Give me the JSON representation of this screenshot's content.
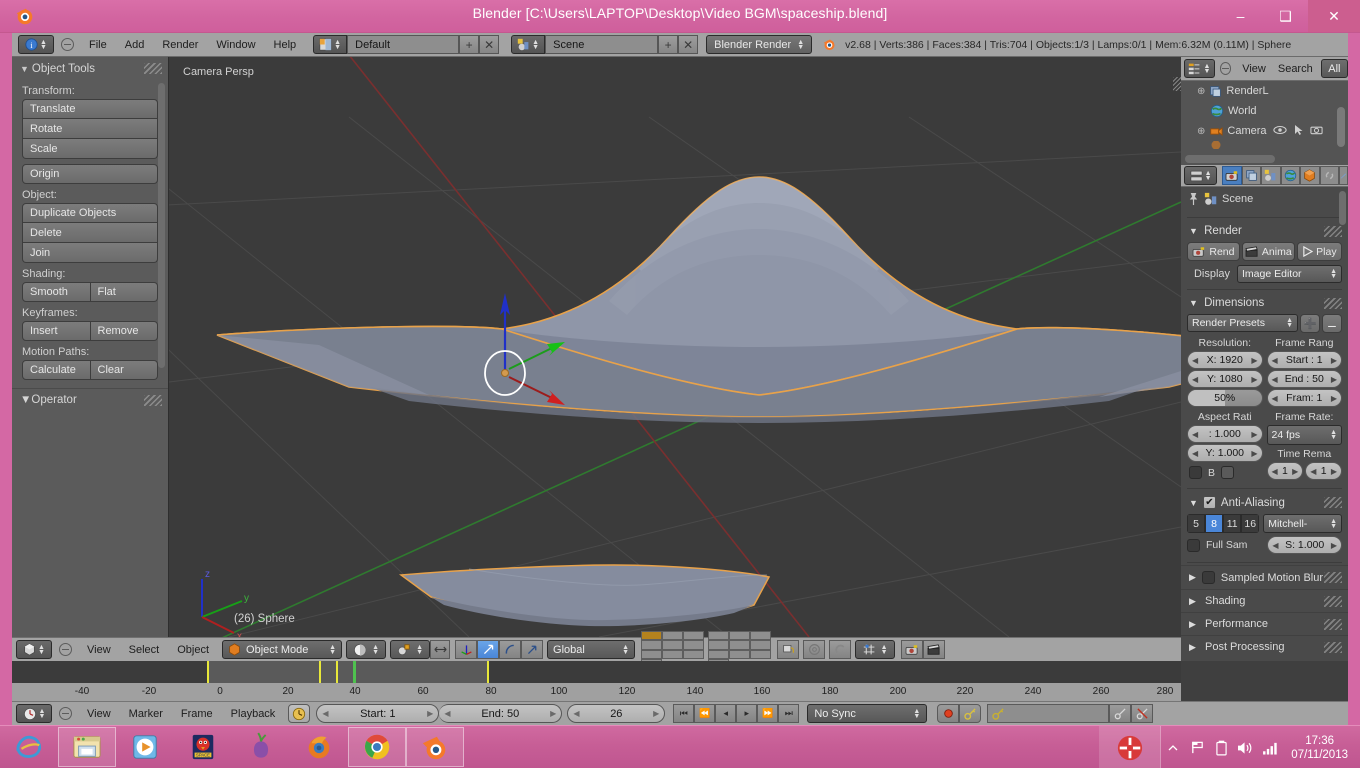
{
  "window": {
    "title": "Blender [C:\\Users\\LAPTOP\\Desktop\\Video BGM\\spaceship.blend]",
    "minimize": "–",
    "maximize": "❑",
    "close": "✕"
  },
  "header": {
    "menus": [
      "File",
      "Add",
      "Render",
      "Window",
      "Help"
    ],
    "screen_layout": "Default",
    "scene_name": "Scene",
    "engine": "Blender Render",
    "add_label": "+",
    "remove_label": "✕",
    "stats": "v2.68 | Verts:386 | Faces:384 | Tris:704 | Objects:1/3 | Lamps:0/1 | Mem:6.32M (0.11M) | Sphere"
  },
  "tool_panel": {
    "title": "Object Tools",
    "sections": [
      {
        "label": "Transform:",
        "buttons": [
          "Translate",
          "Rotate",
          "Scale"
        ]
      },
      {
        "label": "",
        "buttons": [
          "Origin"
        ]
      },
      {
        "label": "Object:",
        "buttons": [
          "Duplicate Objects",
          "Delete",
          "Join"
        ]
      },
      {
        "label": "Shading:",
        "buttons": [
          "Smooth",
          "Flat"
        ]
      },
      {
        "label": "Keyframes:",
        "buttons": [
          "Insert",
          "Remove"
        ]
      },
      {
        "label": "Motion Paths:",
        "buttons": [
          "Calculate",
          "Clear"
        ]
      }
    ],
    "operator_title": "Operator"
  },
  "viewport": {
    "view_label": "Camera Persp",
    "object_label": "(26) Sphere",
    "axis_x": "x",
    "axis_y": "y",
    "axis_z": "z",
    "header": {
      "menus": [
        "View",
        "Select",
        "Object"
      ],
      "mode": "Object Mode",
      "transform_orientation": "Global"
    }
  },
  "outliner": {
    "menus": [
      "View",
      "Search"
    ],
    "filter": "All",
    "rows": [
      {
        "name": "RenderL",
        "icon": "renderlayers-icon"
      },
      {
        "name": "World",
        "icon": "world-icon"
      },
      {
        "name": "Camera",
        "icon": "camera-icon"
      }
    ]
  },
  "properties": {
    "tabs": [
      "render-tab",
      "renderlayers-tab",
      "scene-tab",
      "world-tab",
      "object-tab",
      "constraints-tab",
      "modifiers-tab"
    ],
    "active_tab": 0,
    "scene_name": "Scene",
    "render": {
      "title": "Render",
      "render_button": "Rend",
      "animation_button": "Anima",
      "play_button": "Play",
      "display_label": "Display",
      "display_value": "Image Editor"
    },
    "dimensions": {
      "title": "Dimensions",
      "presets": "Render Presets",
      "resolution_label": "Resolution:",
      "res_x": "X: 1920",
      "res_y": "Y: 1080",
      "res_percent": "50%",
      "frame_range_label": "Frame Rang",
      "frame_start": "Start : 1",
      "frame_end": "End : 50",
      "frame_step": "Fram: 1",
      "aspect_label": "Aspect Rati",
      "aspect_x": ": 1.000",
      "aspect_y": "Y: 1.000",
      "border_label": "B",
      "frame_rate_label": "Frame Rate:",
      "frame_rate": "24 fps",
      "time_remap_label": "Time Rema",
      "time_old": "1",
      "time_new": "1"
    },
    "antialiasing": {
      "title": "Anti-Aliasing",
      "enabled": true,
      "samples": [
        "5",
        "8",
        "11",
        "16"
      ],
      "selected_sample": "8",
      "filter": "Mitchell-",
      "full_sample_label": "Full Sam",
      "size_value": "S: 1.000"
    },
    "collapsed_panels": [
      "Sampled Motion Blur",
      "Shading",
      "Performance",
      "Post Processing"
    ]
  },
  "timeline": {
    "menus": [
      "View",
      "Marker",
      "Frame",
      "Playback"
    ],
    "start": "Start: 1",
    "end": "End: 50",
    "current_frame": "26",
    "sync_mode": "No Sync",
    "ruler_ticks": [
      "-40",
      "-20",
      "0",
      "20",
      "40",
      "60",
      "80",
      "100",
      "120",
      "140",
      "160",
      "180",
      "200",
      "220",
      "240",
      "260",
      "280"
    ],
    "keyframes": [
      0,
      20,
      23,
      50
    ],
    "playhead": 26,
    "range_start": 0,
    "range_end": 50,
    "transport": [
      "jump-start-icon",
      "prev-keyframe-icon",
      "play-reverse-icon",
      "play-icon",
      "next-keyframe-icon",
      "jump-end-icon"
    ]
  },
  "taskbar": {
    "apps": [
      {
        "name": "internet-explorer-icon",
        "active": false
      },
      {
        "name": "file-explorer-icon",
        "active": true
      },
      {
        "name": "media-player-icon",
        "active": false
      },
      {
        "name": "angry-birds-space-icon",
        "active": false
      },
      {
        "name": "tor-browser-icon",
        "active": false
      },
      {
        "name": "firefox-icon",
        "active": false
      },
      {
        "name": "chrome-icon",
        "active": true
      },
      {
        "name": "blender-icon",
        "active": true
      }
    ],
    "tray": [
      "show-hidden-icon",
      "flag-icon",
      "battery-icon",
      "volume-icon",
      "network-icon"
    ],
    "time": "17:36",
    "date": "07/11/2013"
  }
}
